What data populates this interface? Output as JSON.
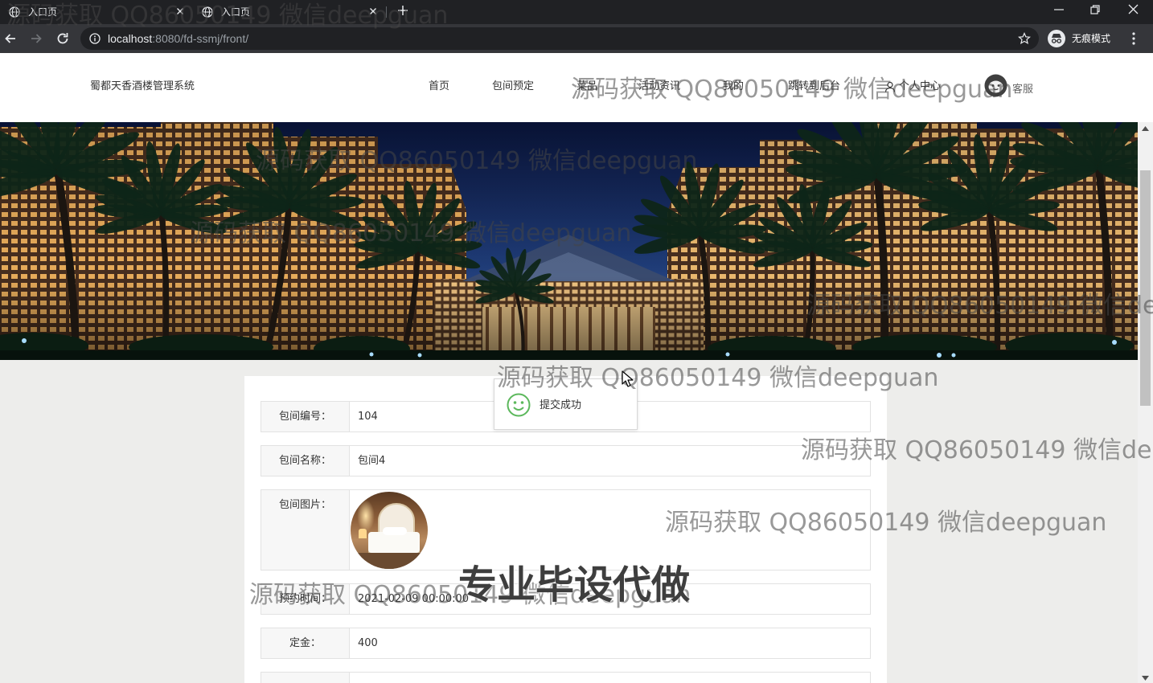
{
  "browser": {
    "tabs": [
      {
        "title": "入口页"
      },
      {
        "title": "入口页"
      }
    ],
    "url": {
      "host": "localhost",
      "path": ":8080/fd-ssmj/front/"
    },
    "incognito_label": "无痕模式"
  },
  "header": {
    "logo": "蜀都天香酒楼管理系统",
    "nav": [
      "首页",
      "包间预定",
      "菜品",
      "活动资讯",
      "我的",
      "跳转到后台"
    ],
    "user_center": "个人中心",
    "service_label": "客服"
  },
  "booking_form": {
    "rows": [
      {
        "label": "包间编号：",
        "value": "104"
      },
      {
        "label": "包间名称：",
        "value": "包间4"
      },
      {
        "label": "包间图片："
      },
      {
        "label": "预约时间：",
        "value": "2021-02-09 00:00:00"
      },
      {
        "label": "定金：",
        "value": "400"
      }
    ]
  },
  "toast": {
    "message": "提交成功",
    "icon": "smile-icon"
  },
  "watermarks": {
    "contact": "源码获取 QQ86050149 微信deepguan",
    "promo": "专业毕设代做"
  },
  "colors": {
    "chrome_dark": "#202124",
    "toolbar": "#35363a",
    "content_bg": "#ededeb",
    "success": "#5cb85c"
  }
}
